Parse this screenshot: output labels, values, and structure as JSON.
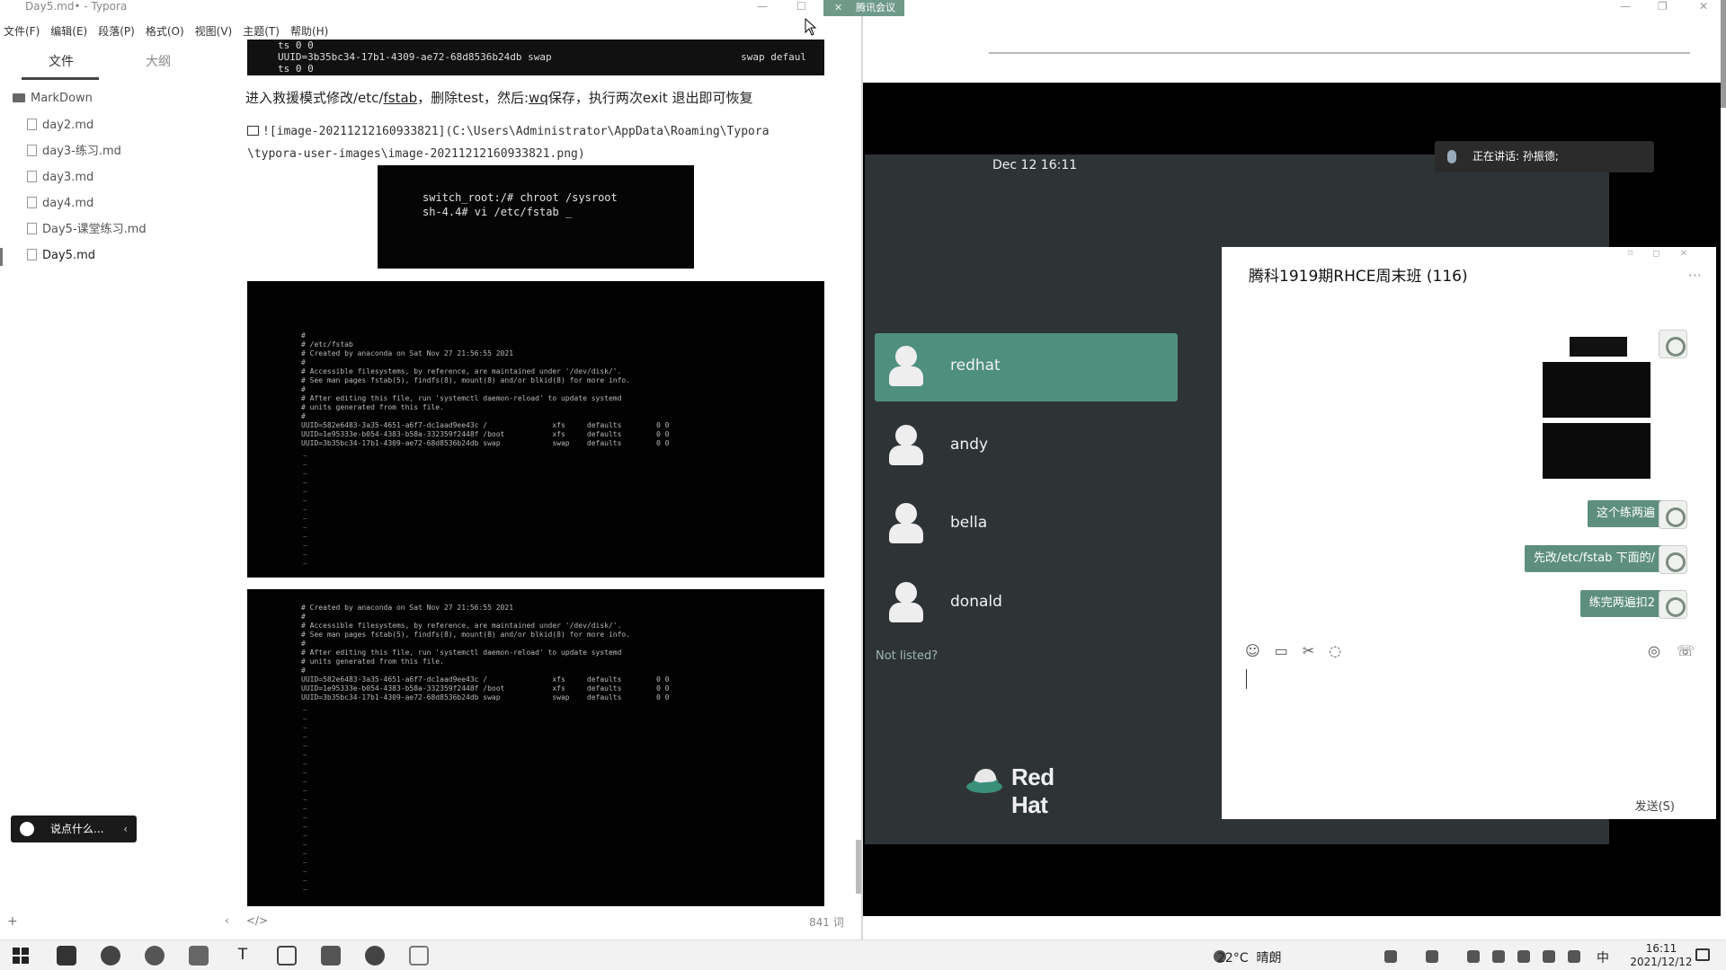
{
  "typora": {
    "title": "Day5.md• - Typora",
    "menu": [
      "文件(F)",
      "编辑(E)",
      "段落(P)",
      "格式(O)",
      "视图(V)",
      "主题(T)",
      "帮助(H)"
    ],
    "tabs": {
      "files": "文件",
      "outline": "大纲"
    },
    "tree": {
      "folder": "MarkDown",
      "files": [
        "day2.md",
        "day3-练习.md",
        "day3.md",
        "day4.md",
        "Day5-课堂练习.md",
        "Day5.md"
      ],
      "active_index": 5
    },
    "chat_pill": "说点什么...",
    "word_count": "841 词",
    "top_terminal": {
      "line1": "ts          0 0",
      "line2": "UUID=3b35bc34-17b1-4309-ae72-68d8536b24db swap",
      "line2_right": "swap    defaul",
      "line3": "ts          0 0"
    },
    "instruction": {
      "before": "进入救援模式修改/etc/",
      "fstab": "fstab",
      "middle": "，删除test，然后:",
      "wq": "wq",
      "after": "保存，执行两次exit 退出即可恢复"
    },
    "image_link": {
      "line1": "![image-20211212160933821](C:\\Users\\Administrator\\AppData\\Roaming\\Typora",
      "line2": "\\typora-user-images\\image-20211212160933821.png)"
    },
    "chroot_image": {
      "line1": "switch_root:/# chroot /sysroot",
      "line2": "sh-4.4# vi /etc/fstab _"
    },
    "shot1_lines": [
      "#",
      "# /etc/fstab",
      "# Created by anaconda on Sat Nov 27 21:56:55 2021",
      "#",
      "# Accessible filesystems, by reference, are maintained under '/dev/disk/'.",
      "# See man pages fstab(5), findfs(8), mount(8) and/or blkid(8) for more info.",
      "#",
      "# After editing this file, run 'systemctl daemon-reload' to update systemd",
      "# units generated from this file.",
      "#",
      "UUID=582e6483-3a35-4651-a6f7-dc1aad9ee43c /               xfs     defaults        0 0",
      "UUID=1e95333e-b054-4383-b58a-332359f2448f /boot           xfs     defaults        0 0",
      "UUID=3b35bc34-17b1-4309-ae72-68d8536b24db swap            swap    defaults        0 0"
    ],
    "shot2_lines": [
      "# Created by anaconda on Sat Nov 27 21:56:55 2021",
      "#",
      "# Accessible filesystems, by reference, are maintained under '/dev/disk/'.",
      "# See man pages fstab(5), findfs(8), mount(8) and/or blkid(8) for more info.",
      "#",
      "# After editing this file, run 'systemctl daemon-reload' to update systemd",
      "# units generated from this file.",
      "#",
      "UUID=582e6483-3a35-4651-a6f7-dc1aad9ee43c /               xfs     defaults        0 0",
      "UUID=1e95333e-b054-4383-b58a-332359f2448f /boot           xfs     defaults        0 0",
      "UUID=3b35bc34-17b1-4309-ae72-68d8536b24db swap            swap    defaults        0 0"
    ]
  },
  "meeting": {
    "badge": "腾讯会议",
    "speaker": "正在讲话: 孙振德;",
    "gdm": {
      "date": "Dec 12  16:11",
      "users": [
        "redhat",
        "andy",
        "bella",
        "donald"
      ],
      "selected_user": "redhat",
      "not_listed": "Not listed?",
      "brand": "Red Hat"
    },
    "chat": {
      "title": "腾科1919期RHCE周末班 (116)",
      "messages": [
        "这个练两遍",
        "先改/etc/fstab 下面的/",
        "练完两遍扣2"
      ],
      "send": "发送(S)"
    }
  },
  "taskbar": {
    "temperature": "22°C",
    "weather": "晴朗",
    "ime": "中",
    "time": "16:11",
    "date": "2021/12/12"
  },
  "colors": {
    "gdm_bg": "#2e3436",
    "gdm_selected": "#4e8f7e",
    "chat_bubble": "#5e8f7e",
    "meeting_badge": "#6f9a8a"
  }
}
